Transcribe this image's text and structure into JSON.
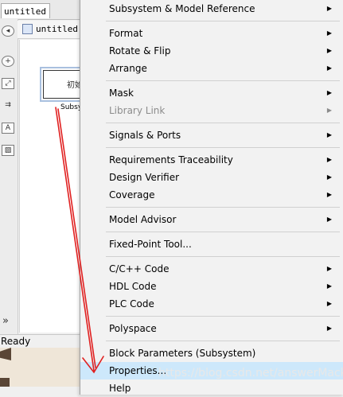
{
  "window": {
    "tab_label": "untitled",
    "address_text": "untitled ▶",
    "block_text": "初始",
    "block_label": "Subsys",
    "status": "Ready",
    "expand_glyph": "»"
  },
  "menu": {
    "subsystem_ref": "Subsystem & Model Reference",
    "format": "Format",
    "rotate_flip": "Rotate & Flip",
    "arrange": "Arrange",
    "mask": "Mask",
    "library_link": "Library Link",
    "signals_ports": "Signals & Ports",
    "req_trace": "Requirements Traceability",
    "design_verifier": "Design Verifier",
    "coverage": "Coverage",
    "model_advisor": "Model Advisor",
    "fixed_point": "Fixed-Point Tool...",
    "cpp_code": "C/C++ Code",
    "hdl_code": "HDL Code",
    "plc_code": "PLC Code",
    "polyspace": "Polyspace",
    "block_params": "Block Parameters (Subsystem)",
    "properties": "Properties...",
    "help": "Help"
  },
  "watermark": "https://blog.csdn.net/answerMack",
  "colors": {
    "menu_bg": "#f2f2f2",
    "highlight": "#cde8fb",
    "disabled_text": "#8c8c8c",
    "annotation_arrow": "#e02020",
    "block_border": "#a9c0df"
  }
}
